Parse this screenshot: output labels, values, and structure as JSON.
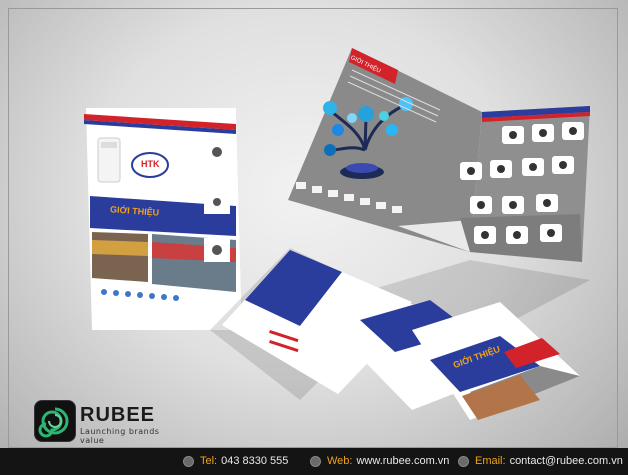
{
  "brand": {
    "name": "RUBEE",
    "tagline": "Launching brands value"
  },
  "contact": {
    "tel_label": "Tel:",
    "tel_value": "043 8330 555",
    "web_label": "Web:",
    "web_value": "www.rubee.com.vn",
    "email_label": "Email:",
    "email_value": "contact@rubee.com.vn"
  },
  "brochure": {
    "cover_heading": "GIỚI THIỆU",
    "inner_heading": "GIỚI THIỆU",
    "insert_heading": "GIỚI THIỆU",
    "cover_logo": "HTK"
  },
  "colors": {
    "accent_orange": "#f0a21a",
    "brochure_blue": "#2a3d9c",
    "brochure_red": "#d2232a",
    "brochure_gray": "#8a8a8a",
    "footer_bg": "#141414"
  }
}
